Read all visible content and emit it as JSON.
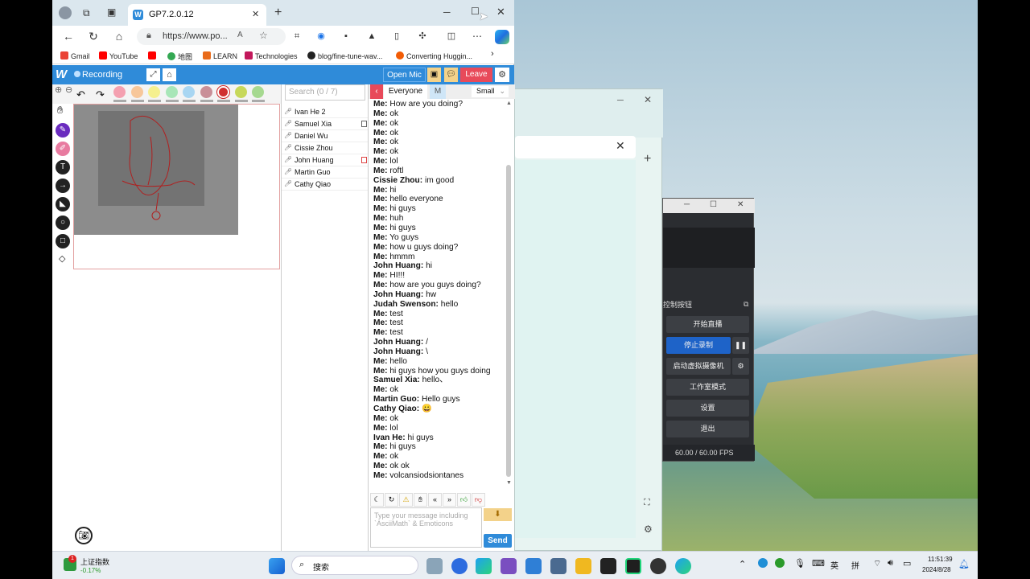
{
  "browser": {
    "tab_title": "GP7.2.0.12",
    "url": "https://www.po...",
    "bookmarks": [
      {
        "label": "Gmail",
        "color": "#ea4335"
      },
      {
        "label": "YouTube",
        "color": "#ff0000"
      },
      {
        "label": "",
        "color": "#ff0000"
      },
      {
        "label": "地图",
        "color": "#34a853"
      },
      {
        "label": "LEARN",
        "color": "#e96b1a"
      },
      {
        "label": "Technologies",
        "color": "#c2185b"
      },
      {
        "label": "blog/fine-tune-wav...",
        "color": "#222222"
      },
      {
        "label": "Converting Huggin...",
        "color": "#f25c05"
      }
    ]
  },
  "app": {
    "recording_label": "Recording",
    "open_mic": "Open Mic",
    "leave": "Leave",
    "accent": "#2f8bd9",
    "swatches": [
      "#f4a0b0",
      "#f7c79a",
      "#f5f08f",
      "#a8e6b8",
      "#a9d6f2",
      "#c98f98",
      "#d03030",
      "#c7d85a",
      "#a6d990"
    ],
    "search_placeholder": "Search (0 / 7)",
    "users": [
      "Ivan He 2",
      "Samuel Xia",
      "Daniel Wu",
      "Cissie Zhou",
      "John Huang",
      "Martin Guo",
      "Cathy Qiao"
    ],
    "chat_tab_everyone": "Everyone",
    "chat_tab_m": "M",
    "font_size": "Small",
    "messages": [
      {
        "from": "Me:",
        "text": "How are you doing?"
      },
      {
        "from": "Me:",
        "text": "ok"
      },
      {
        "from": "Me:",
        "text": "ok"
      },
      {
        "from": "Me:",
        "text": "ok"
      },
      {
        "from": "Me:",
        "text": "ok"
      },
      {
        "from": "Me:",
        "text": "ok"
      },
      {
        "from": "Me:",
        "text": "lol"
      },
      {
        "from": "Me:",
        "text": "roftl"
      },
      {
        "from": "Cissie Zhou:",
        "text": "im good"
      },
      {
        "from": "Me:",
        "text": "hi"
      },
      {
        "from": "Me:",
        "text": "hello everyone"
      },
      {
        "from": "Me:",
        "text": "hi guys"
      },
      {
        "from": "Me:",
        "text": "huh"
      },
      {
        "from": "Me:",
        "text": "hi guys"
      },
      {
        "from": "Me:",
        "text": "Yo guys"
      },
      {
        "from": "Me:",
        "text": "how u guys doing?"
      },
      {
        "from": "Me:",
        "text": "hmmm"
      },
      {
        "from": "John Huang:",
        "text": "hi"
      },
      {
        "from": "Me:",
        "text": "HI!!!"
      },
      {
        "from": "Me:",
        "text": "how are you guys doing?"
      },
      {
        "from": "John Huang:",
        "text": "hw"
      },
      {
        "from": "Judah Swenson:",
        "text": "hello"
      },
      {
        "from": "Me:",
        "text": "test"
      },
      {
        "from": "Me:",
        "text": "test"
      },
      {
        "from": "Me:",
        "text": "test"
      },
      {
        "from": "John Huang:",
        "text": "/"
      },
      {
        "from": "John Huang:",
        "text": "\\"
      },
      {
        "from": "Me:",
        "text": "hello"
      },
      {
        "from": "Me:",
        "text": "hi guys how you guys doing"
      },
      {
        "from": "Samuel Xia:",
        "text": "hello、"
      },
      {
        "from": "Me:",
        "text": "ok"
      },
      {
        "from": "Martin Guo:",
        "text": "Hello guys"
      },
      {
        "from": "Cathy Qiao:",
        "text": "😀"
      },
      {
        "from": "Me:",
        "text": "ok"
      },
      {
        "from": "Me:",
        "text": "lol"
      },
      {
        "from": "Ivan He:",
        "text": "hi guys"
      },
      {
        "from": "Me:",
        "text": "hi guys"
      },
      {
        "from": "Me:",
        "text": "ok"
      },
      {
        "from": "Me:",
        "text": "ok ok"
      },
      {
        "from": "Me:",
        "text": "volcansiodsiontanes"
      }
    ],
    "input_placeholder": "Type your message including `AsciiMath` & Emoticons",
    "send": "Send"
  },
  "obs": {
    "panel_title": "控制按钮",
    "buttons": [
      "开始直播",
      "停止录制",
      "启动虚拟摄像机",
      "工作室模式",
      "设置",
      "退出"
    ],
    "fps": "60.00 / 60.00 FPS"
  },
  "taskbar": {
    "stock_name": "上证指数",
    "stock_change": "-0.17%",
    "search": "搜索",
    "ime_1": "英",
    "ime_2": "拼",
    "time": "11:51:39",
    "date": "2024/8/28"
  }
}
